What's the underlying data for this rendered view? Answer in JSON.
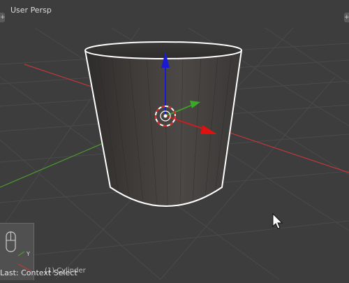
{
  "viewport": {
    "view_label": "User Persp",
    "object_info": "(1) Cylinder",
    "last_operator": "Last: Context Select",
    "mini_axis_label": "Y"
  },
  "corner_widgets": {
    "left": "+",
    "right": "+"
  },
  "colors": {
    "background": "#3d3d3d",
    "grid": "#4a4a4a",
    "x_axis": "#b93a3a",
    "y_axis": "#4e9a2f",
    "z_axis": "#1a1ad6",
    "mesh_outline": "#ffffff",
    "mesh_fill_dark": "#2f2d2b",
    "mesh_fill_light": "#4c4946"
  },
  "icons": [
    "manipulator-z-arrow",
    "manipulator-x-arrow",
    "manipulator-y-arrow",
    "3d-cursor-icon",
    "mouse-cursor-icon",
    "mouse-navigation-icon"
  ]
}
